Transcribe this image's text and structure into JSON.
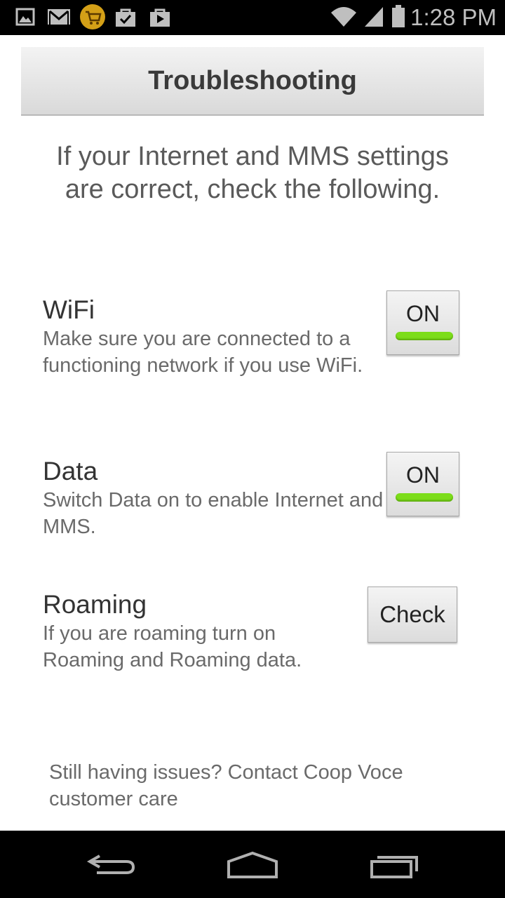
{
  "status_bar": {
    "time": "1:28 PM",
    "icons": [
      "gallery-icon",
      "gmail-icon",
      "shop-icon",
      "bag-check-icon",
      "bag-play-icon",
      "wifi-icon",
      "signal-icon",
      "battery-icon"
    ]
  },
  "header": {
    "title": "Troubleshooting"
  },
  "intro": "If your Internet and MMS settings are correct, check the following.",
  "sections": [
    {
      "title": "WiFi",
      "description": "Make sure you are connected to a functioning network if you use WiFi.",
      "control_label": "ON",
      "state": "on"
    },
    {
      "title": "Data",
      "description": "Switch Data on to enable Internet and MMS.",
      "control_label": "ON",
      "state": "on"
    },
    {
      "title": "Roaming",
      "description": "If you are roaming turn on Roaming and Roaming data.",
      "control_label": "Check"
    }
  ],
  "footer_note": "Still having issues? Contact Coop Voce customer care",
  "colors": {
    "toggle_on": "#7cdd1a",
    "status_bar": "#000000",
    "header_text": "#3a3a3a"
  },
  "nav_bar": {
    "icons": [
      "back-icon",
      "home-icon",
      "recents-icon"
    ]
  }
}
